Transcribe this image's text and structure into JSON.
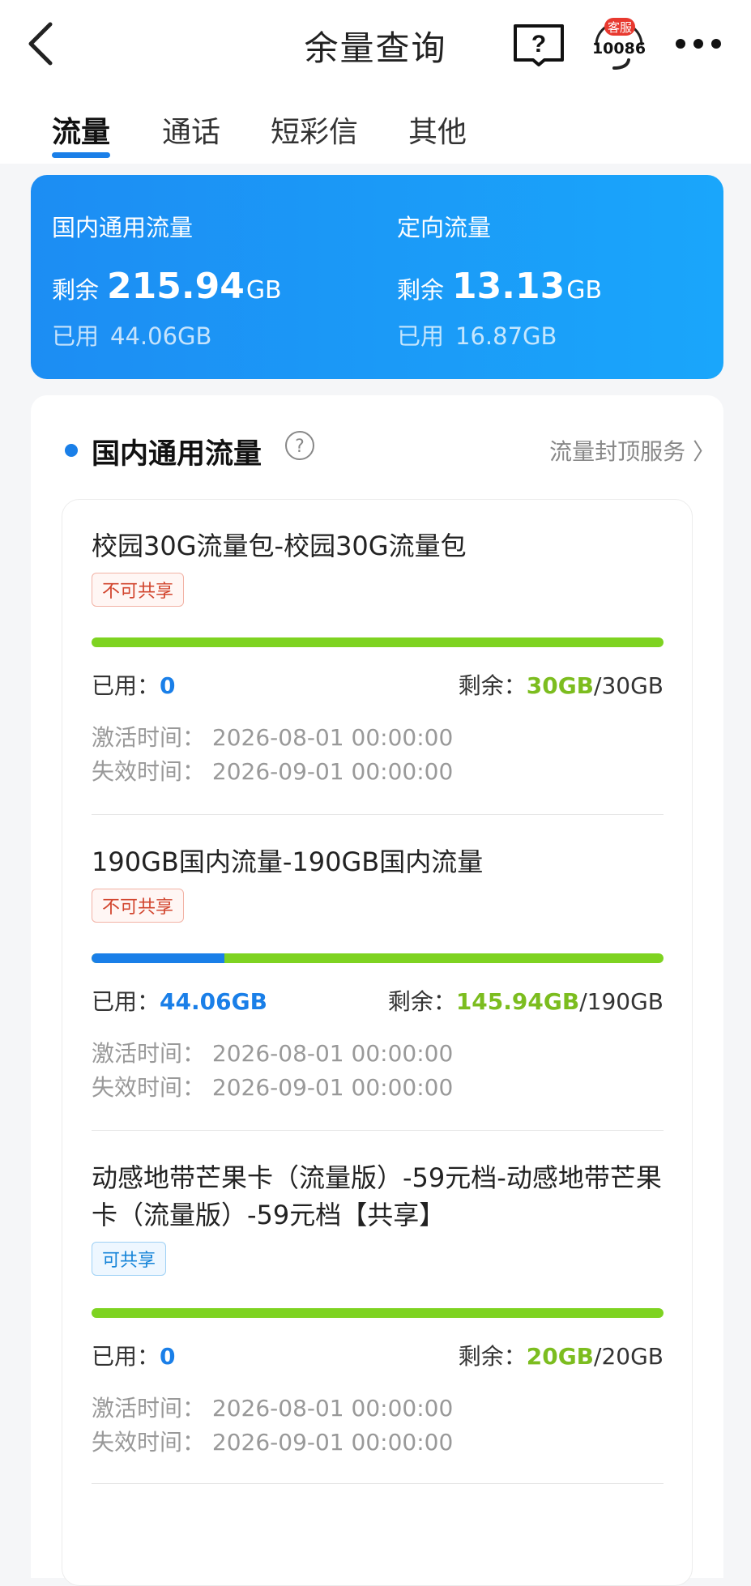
{
  "header": {
    "title": "余量查询",
    "service_badge": "客服",
    "service_number": "10086"
  },
  "tabs": [
    "流量",
    "通话",
    "短彩信",
    "其他"
  ],
  "summary": [
    {
      "title": "国内通用流量",
      "remain_label": "剩余",
      "remain_value": "215.94",
      "remain_unit": "GB",
      "used_label": "已用",
      "used_value": "44.06GB"
    },
    {
      "title": "定向流量",
      "remain_label": "剩余",
      "remain_value": "13.13",
      "remain_unit": "GB",
      "used_label": "已用",
      "used_value": "16.87GB"
    }
  ],
  "section": {
    "title": "国内通用流量",
    "help": "?",
    "link": "流量封顶服务 〉"
  },
  "packages": [
    {
      "name": "校园30G流量包-校园30G流量包",
      "badge": "不可共享",
      "used_fraction": 0,
      "used_label": "已用：",
      "used_value": "0",
      "remain_label": "剩余：",
      "remain_value": "30GB",
      "total": "/30GB",
      "activate": "激活时间：  2026-08-01 00:00:00",
      "expire": "失效时间：  2026-09-01 00:00:00"
    },
    {
      "name": "190GB国内流量-190GB国内流量",
      "badge": "不可共享",
      "used_fraction": 0.232,
      "used_label": "已用：",
      "used_value": "44.06GB",
      "remain_label": "剩余：",
      "remain_value": "145.94GB",
      "total": "/190GB",
      "activate": "激活时间：  2026-08-01 00:00:00",
      "expire": "失效时间：  2026-09-01 00:00:00"
    },
    {
      "name": "动感地带芒果卡（流量版）-59元档-动感地带芒果卡（流量版）-59元档【共享】",
      "badge": "可共享",
      "used_fraction": 0,
      "used_label": "已用：",
      "used_value": "0",
      "remain_label": "剩余：",
      "remain_value": "20GB",
      "total": "/20GB",
      "activate": "激活时间：  2026-08-01 00:00:00",
      "expire": "失效时间：  2026-09-01 00:00:00"
    }
  ],
  "colors": {
    "accent": "#1a7fe8",
    "remain": "#7cbd1f",
    "badge_noshare": "#d2452e",
    "badge_share": "#1684d8"
  }
}
